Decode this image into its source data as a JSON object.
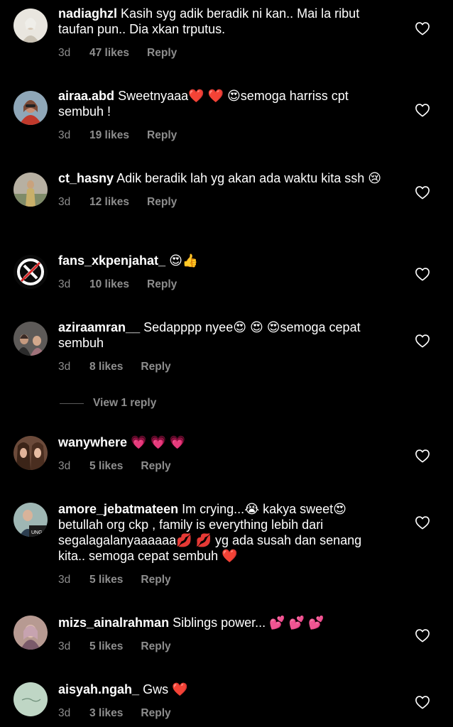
{
  "colors": {
    "background": "#000000",
    "text": "#ffffff",
    "secondary": "#8e8e8e"
  },
  "comments": [
    {
      "username": "nadiaghzl",
      "text": "Kasih syg adik beradik ni kan.. Mai la ribut taufan pun.. Dia xkan trputus.",
      "time": "3d",
      "likes": "47 likes",
      "reply": "Reply"
    },
    {
      "username": "airaa.abd",
      "text": "Sweetnyaaa❤️ ❤️ 😍semoga harriss cpt sembuh !",
      "time": "3d",
      "likes": "19 likes",
      "reply": "Reply"
    },
    {
      "username": "ct_hasny",
      "text": "Adik beradik lah yg akan ada waktu kita ssh 😢",
      "time": "3d",
      "likes": "12 likes",
      "reply": "Reply"
    },
    {
      "username": "fans_xkpenjahat_",
      "text": "😍👍",
      "time": "3d",
      "likes": "10 likes",
      "reply": "Reply"
    },
    {
      "username": "aziraamran__",
      "text": "Sedapppp nyee😍 😍 😍semoga cepat sembuh",
      "time": "3d",
      "likes": "8 likes",
      "reply": "Reply"
    },
    {
      "username": "wanywhere",
      "text": "💗 💗 💗",
      "time": "3d",
      "likes": "5 likes",
      "reply": "Reply"
    },
    {
      "username": "amore_jebatmateen",
      "text": "Im crying...😭 kakya sweet😍 betullah org ckp , family is everything lebih dari segalagalanyaaaaaa💋 💋 yg ada susah dan senang kita.. semoga cepat sembuh ❤️",
      "time": "3d",
      "likes": "5 likes",
      "reply": "Reply"
    },
    {
      "username": "mizs_ainalrahman",
      "text": "Siblings power... 💕 💕 💕",
      "time": "3d",
      "likes": "5 likes",
      "reply": "Reply"
    },
    {
      "username": "aisyah.ngah_",
      "text": "Gws ❤️",
      "time": "3d",
      "likes": "3 likes",
      "reply": "Reply"
    }
  ],
  "view_replies": {
    "label": "View 1 reply"
  },
  "icons": {
    "like": "heart-outline-icon"
  }
}
